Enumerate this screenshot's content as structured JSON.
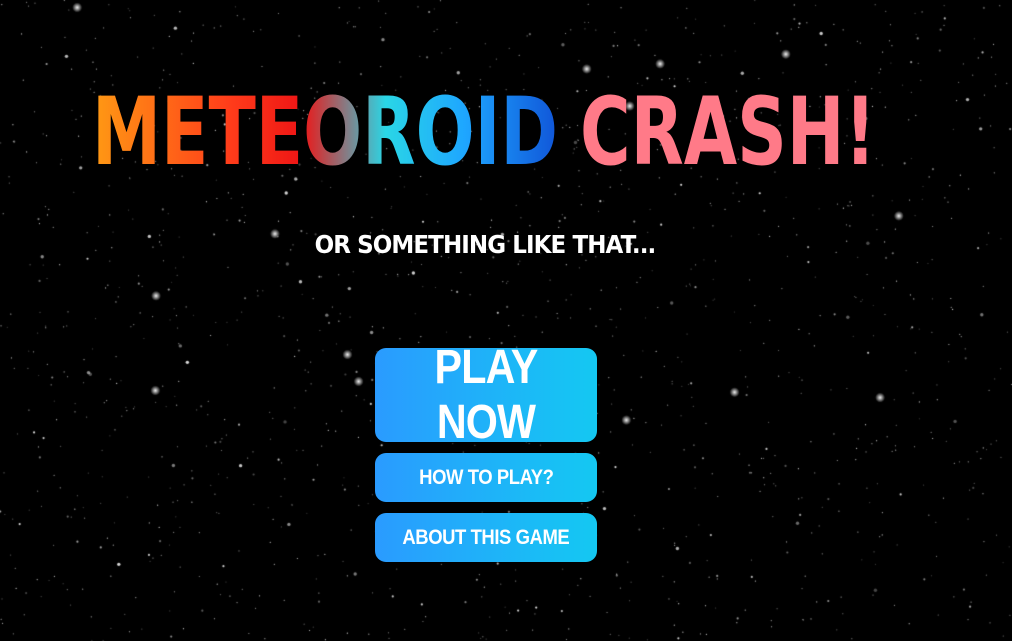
{
  "game": {
    "title_part1": "METEOROID",
    "title_part2": "CRASH!",
    "subtitle": "OR SOMETHING LIKE THAT...",
    "colors": {
      "background": "#000000",
      "button_gradient_start": "#2a9bff",
      "button_gradient_end": "#14c8f2",
      "title_part1_gradient": [
        "#ff9a14",
        "#ff3b1a",
        "#ee1515",
        "#2ad6e6",
        "#1ea6ff",
        "#1055d8"
      ],
      "title_part2_color": "#ff7a88"
    }
  },
  "menu": {
    "play_label": "PLAY NOW",
    "how_label": "HOW TO PLAY?",
    "about_label": "ABOUT THIS GAME"
  }
}
